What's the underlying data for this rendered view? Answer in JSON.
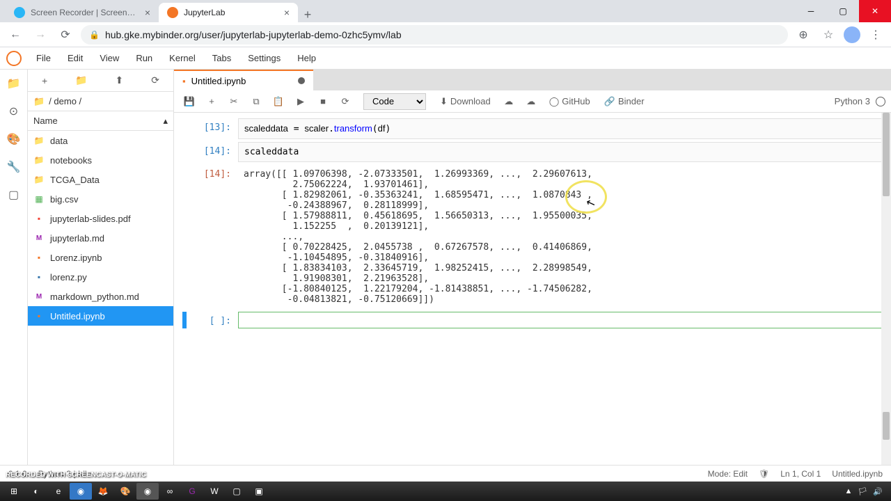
{
  "browser": {
    "tabs": [
      {
        "title": "Screen Recorder | Screencast-O...",
        "active": false
      },
      {
        "title": "JupyterLab",
        "active": true
      }
    ],
    "url": "hub.gke.mybinder.org/user/jupyterlab-jupyterlab-demo-0zhc5ymv/lab"
  },
  "menubar": [
    "File",
    "Edit",
    "View",
    "Run",
    "Kernel",
    "Tabs",
    "Settings",
    "Help"
  ],
  "breadcrumb": "/ demo /",
  "fb_header": "Name",
  "files": [
    {
      "name": "data",
      "icon": "folder-icon"
    },
    {
      "name": "notebooks",
      "icon": "folder-icon"
    },
    {
      "name": "TCGA_Data",
      "icon": "folder-icon"
    },
    {
      "name": "big.csv",
      "icon": "csv-icon"
    },
    {
      "name": "jupyterlab-slides.pdf",
      "icon": "pdf-icon"
    },
    {
      "name": "jupyterlab.md",
      "icon": "md-icon"
    },
    {
      "name": "Lorenz.ipynb",
      "icon": "ipynb-icon"
    },
    {
      "name": "lorenz.py",
      "icon": "py-icon"
    },
    {
      "name": "markdown_python.md",
      "icon": "md-icon"
    },
    {
      "name": "Untitled.ipynb",
      "icon": "ipynb-icon",
      "selected": true
    }
  ],
  "notebook_tab": "Untitled.ipynb",
  "cell_type": "Code",
  "toolbar_links": {
    "download": "Download",
    "github": "GitHub",
    "binder": "Binder"
  },
  "kernel_name": "Python 3",
  "cells": {
    "c13_prompt": "[13]:",
    "c13_code": "scaleddata = scaler.transform(df)",
    "c14_prompt": "[14]:",
    "c14_code": "scaleddata",
    "c14_out_prompt": "[14]:",
    "c14_output": "array([[ 1.09706398, -2.07333501,  1.26993369, ...,  2.29607613,\n         2.75062224,  1.93701461],\n       [ 1.82982061, -0.35363241,  1.68595471, ...,  1.0870843 ,\n        -0.24388967,  0.28118999],\n       [ 1.57988811,  0.45618695,  1.56650313, ...,  1.95500035,\n         1.152255  ,  0.20139121],\n       ...,\n       [ 0.70228425,  2.0455738 ,  0.67267578, ...,  0.41406869,\n        -1.10454895, -0.31840916],\n       [ 1.83834103,  2.33645719,  1.98252415, ...,  2.28998549,\n         1.91908301,  2.21963528],\n       [-1.80840125,  1.22179204, -1.81438851, ..., -1.74506282,\n        -0.04813821, -0.75120669]])",
    "empty_prompt": "[ ]:"
  },
  "status": {
    "left_counts": "0    1    0",
    "kernel": "Python 3 | Idle",
    "mode": "Mode: Edit",
    "cursor": "Ln 1, Col 1",
    "file": "Untitled.ipynb"
  },
  "watermark": "RECORDED WITH\nSCREENCAST-O-MATIC"
}
